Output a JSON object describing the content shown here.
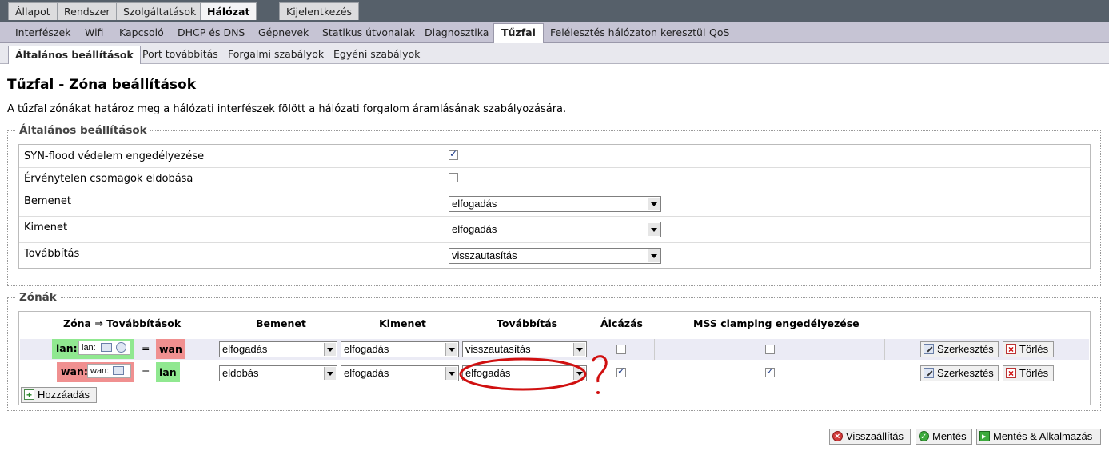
{
  "top_tabs": [
    "Állapot",
    "Rendszer",
    "Szolgáltatások",
    "Hálózat",
    "Kijelentkezés"
  ],
  "nav_tabs": [
    "Interfészek",
    "Wifi",
    "Kapcsoló",
    "DHCP és DNS",
    "Gépnevek",
    "Statikus útvonalak",
    "Diagnosztika",
    "Tűzfal",
    "Felélesztés hálózaton keresztül",
    "QoS"
  ],
  "sub_tabs": [
    "Általános beállítások",
    "Port továbbítás",
    "Forgalmi szabályok",
    "Egyéni szabályok"
  ],
  "page": {
    "title": "Tűzfal - Zóna beállítások",
    "description": "A tűzfal zónákat határoz meg a hálózati interfészek fölött a hálózati forgalom áramlásának szabályozására."
  },
  "general": {
    "legend": "Általános beállítások",
    "syn_flood_label": "SYN-flood védelem engedélyezése",
    "syn_flood_checked": true,
    "drop_invalid_label": "Érvénytelen csomagok eldobása",
    "drop_invalid_checked": false,
    "input_label": "Bemenet",
    "input_value": "elfogadás",
    "output_label": "Kimenet",
    "output_value": "elfogadás",
    "forward_label": "Továbbítás",
    "forward_value": "visszautasítás"
  },
  "zones": {
    "legend": "Zónák",
    "headers": {
      "zone": "Zóna ⇒ Továbbítások",
      "input": "Bemenet",
      "output": "Kimenet",
      "forward": "Továbbítás",
      "masq": "Álcázás",
      "mss": "MSS clamping engedélyezése"
    },
    "rows": [
      {
        "zone": "lan:",
        "network": "lan:",
        "eq": "=",
        "dest": "wan",
        "input": "elfogadás",
        "output": "elfogadás",
        "forward": "visszautasítás",
        "masq": false,
        "mss": false,
        "edit_label": "Szerkesztés",
        "delete_label": "Törlés"
      },
      {
        "zone": "wan:",
        "network": "wan:",
        "eq": "=",
        "dest": "lan",
        "input": "eldobás",
        "output": "elfogadás",
        "forward": "elfogadás",
        "masq": true,
        "mss": true,
        "edit_label": "Szerkesztés",
        "delete_label": "Törlés"
      }
    ],
    "add_label": "Hozzáadás"
  },
  "actions": {
    "reset_label": "Visszaállítás",
    "save_label": "Mentés",
    "save_apply_label": "Mentés & Alkalmazás"
  },
  "colors": {
    "lan_zone": "#90e890",
    "wan_zone": "#f09090",
    "annotation": "#d01010"
  }
}
